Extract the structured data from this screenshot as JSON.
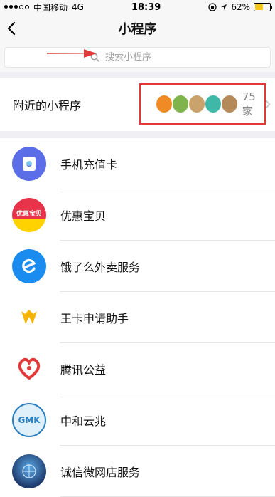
{
  "status": {
    "carrier": "中国移动",
    "network": "4G",
    "time": "18:39",
    "battery": "62%",
    "battery_level": 0.62
  },
  "nav": {
    "title": "小程序"
  },
  "search": {
    "placeholder": "搜索小程序"
  },
  "nearby": {
    "label": "附近的小程序",
    "count": "75家",
    "icon_colors": [
      "#f08a24",
      "#7fb34c",
      "#c9a36b",
      "#3fb8a8",
      "#b58a5a"
    ]
  },
  "programs": [
    {
      "name": "手机充值卡",
      "icon": "phone-card-icon",
      "color": "#5b6ee8"
    },
    {
      "name": "优惠宝贝",
      "icon": "discount-icon",
      "color": "#e8344a",
      "badge": "优惠宝贝"
    },
    {
      "name": "饿了么外卖服务",
      "icon": "eleme-icon",
      "color": "#1a8cf0"
    },
    {
      "name": "王卡申请助手",
      "icon": "king-card-icon",
      "color": "#f4b400"
    },
    {
      "name": "腾讯公益",
      "icon": "tencent-charity-icon",
      "color": "#e23a3a"
    },
    {
      "name": "中和云兆",
      "icon": "gmk-icon",
      "color": "#2a7fc1",
      "badge": "GMK"
    },
    {
      "name": "诚信微网店服务",
      "icon": "credit-shop-icon",
      "color": "#1f3b6d"
    }
  ],
  "colors": {
    "accent_red": "#e23a3a",
    "background": "#efeff4"
  }
}
